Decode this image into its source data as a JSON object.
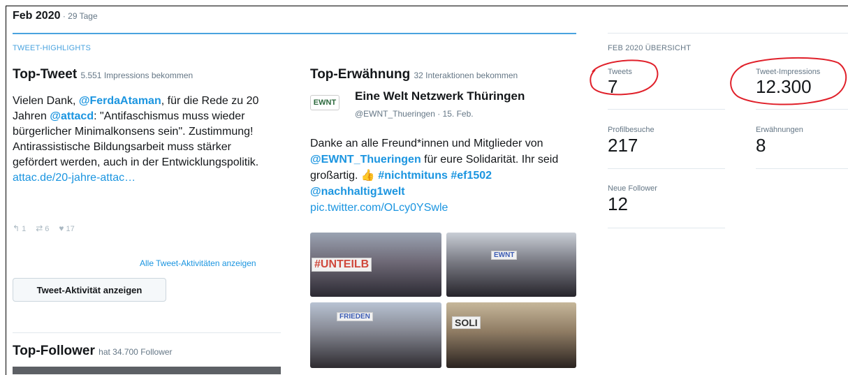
{
  "header": {
    "month": "Feb 2020",
    "days": " · 29 Tage"
  },
  "highlights": {
    "label": "TWEET-HIGHLIGHTS",
    "top_tweet": {
      "title": "Top-Tweet",
      "subtitle": "5.551 Impressions bekommen",
      "text_1": "Vielen Dank, ",
      "mention_1": "@FerdaAtaman",
      "text_2": ", für die Rede zu 20 Jahren ",
      "mention_2": "@attacd",
      "text_3": ": \"Antifaschismus muss wieder bürgerlicher Minimalkonsens sein\". Zustimmung! Antirassistische Bildungsarbeit muss stärker gefördert werden, auch in der Entwicklungspolitik. ",
      "link": "attac.de/20-jahre-attac…",
      "replies": "1",
      "retweets": "6",
      "likes": "17",
      "all_activity_link": "Alle Tweet-Aktivitäten anzeigen",
      "activity_button": "Tweet-Aktivität anzeigen"
    },
    "top_mention": {
      "title": "Top-Erwähnung",
      "subtitle": "32 Interaktionen bekommen",
      "avatar_text": "EWNT",
      "account_name": "Eine Welt Netzwerk Thüringen",
      "handle_date": "@EWNT_Thueringen · 15. Feb.",
      "text_1": "Danke an alle Freund*innen und Mitglieder von ",
      "mention": "@EWNT_Thueringen",
      "text_2": " für eure Solidarität. Ihr seid großartig. ",
      "emoji": "👍",
      "hashtag_1": "#nichtmituns",
      "hashtag_2": "#ef1502",
      "mention_2": "@nachhaltig1welt",
      "pic_link": "pic.twitter.com/OLcy0YSwle",
      "photo_sign_1": "#UNTEILB",
      "photo_sign_2": "EWNT",
      "photo_sign_3": "FRIEDEN",
      "photo_sign_4": "SOLI"
    },
    "top_follower": {
      "title": "Top-Follower",
      "subtitle": "hat 34.700 Follower"
    }
  },
  "overview": {
    "label": "FEB 2020 ÜBERSICHT",
    "tweets": {
      "label": "Tweets",
      "value": "7"
    },
    "impressions": {
      "label": "Tweet-Impressions",
      "value": "12.300"
    },
    "profile_visits": {
      "label": "Profilbesuche",
      "value": "217"
    },
    "mentions": {
      "label": "Erwähnungen",
      "value": "8"
    },
    "new_followers": {
      "label": "Neue Follower",
      "value": "12"
    }
  },
  "colors": {
    "accent": "#1b95e0",
    "rule": "#4aa3df",
    "annotation": "#e0202a"
  }
}
